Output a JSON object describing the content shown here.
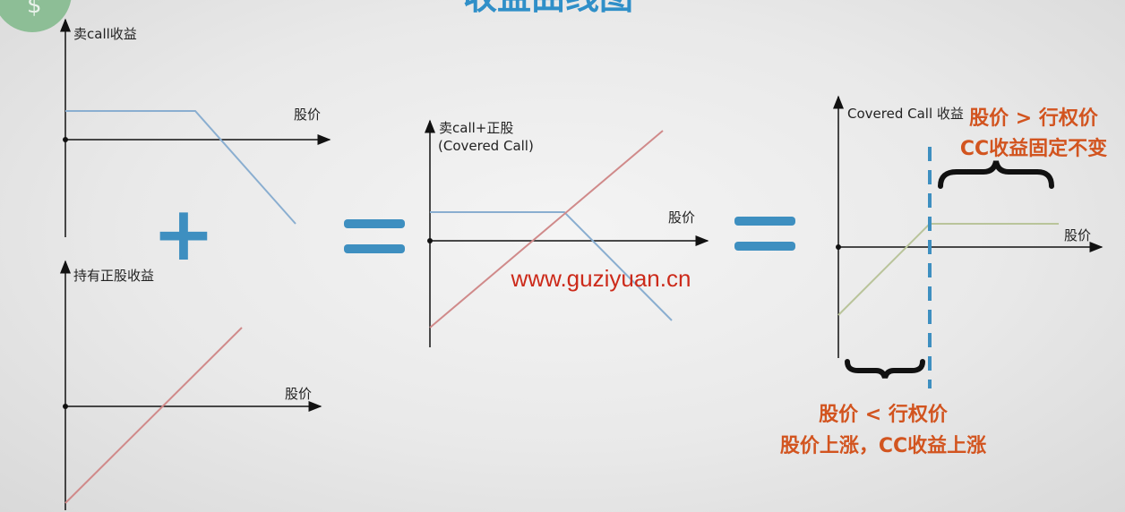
{
  "colors": {
    "title": "#2f8fc8",
    "axis": "#111111",
    "call_line": "#8aaed0",
    "stock_line": "#d08a8a",
    "cc_line": "#b9c49a",
    "operator": "#3e8fc0",
    "annotation": "#d2541f",
    "watermark": "#cc2a1a",
    "dash": "#3e8fc0"
  },
  "title": "收益曲线图",
  "panels": {
    "sell_call": {
      "ylabel": "卖call收益",
      "xlabel": "股价"
    },
    "hold_stock": {
      "ylabel": "持有正股收益",
      "xlabel": "股价"
    },
    "covered_call_combined": {
      "ylabel_line1": "卖call+正股",
      "ylabel_line2": "(Covered Call)",
      "xlabel": "股价"
    },
    "covered_call": {
      "ylabel": "Covered Call 收益",
      "xlabel": "股价"
    }
  },
  "operators": {
    "plus": "+",
    "equals1": "=",
    "equals2": "="
  },
  "watermark": "www.guziyuan.cn",
  "annotations": {
    "above_strike_line1": "股价 > 行权价",
    "above_strike_line2": "CC收益固定不变",
    "below_strike_line1": "股价 < 行权价",
    "below_strike_line2": "股价上涨，CC收益上涨"
  },
  "icons": {
    "corner_badge": "dollar-badge-icon"
  }
}
